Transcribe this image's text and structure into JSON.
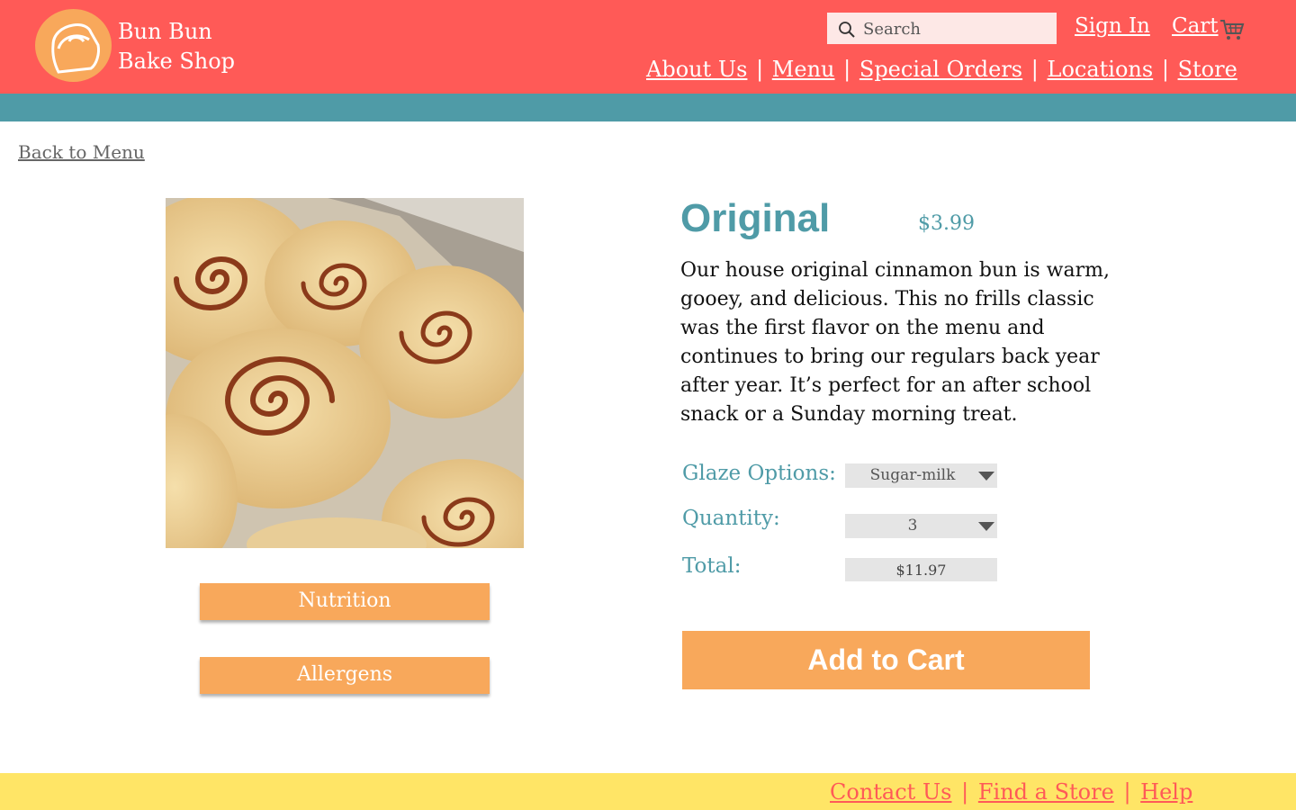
{
  "header": {
    "brand_line1": "Bun Bun",
    "brand_line2": "Bake Shop",
    "search_placeholder": "Search",
    "signin_label": "Sign In",
    "cart_label": "Cart",
    "nav": {
      "about": "About Us",
      "menu": "Menu",
      "special_orders": "Special Orders",
      "locations": "Locations",
      "store": "Store",
      "separator": "|"
    }
  },
  "back_link": "Back to Menu",
  "product": {
    "name": "Original",
    "price": "$3.99",
    "description": "Our house original cinnamon bun is warm, gooey, and delicious. This no frills classic was the first flavor on the menu and continues to bring our regulars back year after year. It’s perfect for an after school snack or a Sunday morning treat.",
    "glaze_label": "Glaze Options:",
    "glaze_value": "Sugar-milk",
    "quantity_label": "Quantity:",
    "quantity_value": "3",
    "total_label": "Total:",
    "total_value": "$11.97",
    "add_to_cart": "Add to Cart",
    "nutrition_button": "Nutrition",
    "allergens_button": "Allergens"
  },
  "footer": {
    "contact": "Contact Us",
    "find_store": "Find a Store",
    "help": "Help",
    "separator": "|"
  },
  "colors": {
    "header": "#ff5a57",
    "teal": "#4f9ba7",
    "orange": "#f8a85b",
    "footer": "#ffe566"
  },
  "icons": [
    "bun-logo-icon",
    "search-icon",
    "cart-icon",
    "dropdown-caret-icon"
  ]
}
